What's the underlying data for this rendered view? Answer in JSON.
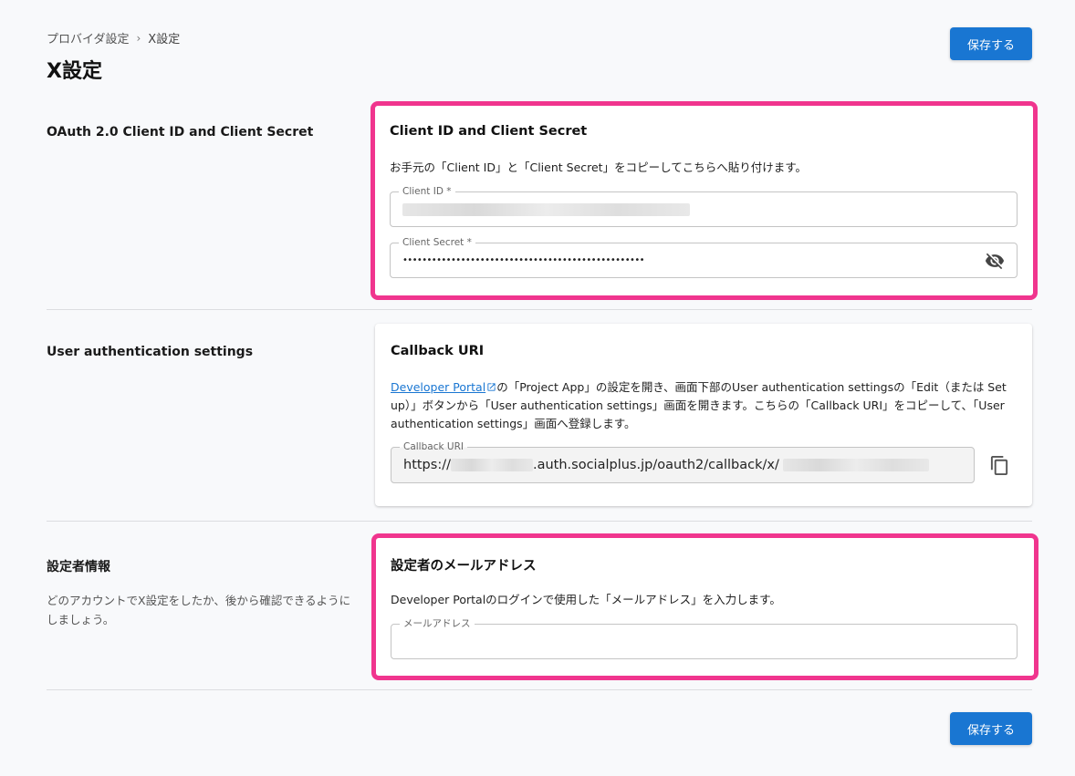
{
  "header": {
    "breadcrumb_parent": "プロバイダ設定",
    "breadcrumb_separator": "›",
    "breadcrumb_current": "X設定",
    "title": "X設定",
    "save_label": "保存する"
  },
  "sections": {
    "oauth": {
      "label": "OAuth 2.0 Client ID and Client Secret",
      "card_title": "Client ID and Client Secret",
      "instruction": "お手元の「Client ID」と「Client Secret」をコピーしてこちらへ貼り付けます。",
      "client_id_label": "Client ID *",
      "client_secret_label": "Client Secret *",
      "client_secret_value": "••••••••••••••••••••••••••••••••••••••••••••••••••"
    },
    "user_auth": {
      "label": "User authentication settings",
      "card_title": "Callback URI",
      "link_text": "Developer Portal",
      "instruction_rest": "の「Project App」の設定を開き、画面下部のUser authentication settingsの「Edit（または Set up）」ボタンから「User authentication settings」画面を開きます。こちらの「Callback URI」をコピーして、「User authentication settings」画面へ登録します。",
      "callback_label": "Callback URI",
      "callback_prefix": "https://",
      "callback_middle": ".auth.socialplus.jp/oauth2/callback/x/"
    },
    "operator": {
      "label": "設定者情報",
      "description": "どのアカウントでX設定をしたか、後から確認できるようにしましょう。",
      "card_title": "設定者のメールアドレス",
      "instruction": "Developer Portalのログインで使用した「メールアドレス」を入力します。",
      "email_label": "メールアドレス",
      "email_value": ""
    }
  },
  "colors": {
    "primary": "#1976d2",
    "highlight": "#f0358e"
  },
  "icons": {
    "visibility_toggle": "eye-off-icon",
    "copy": "copy-icon",
    "external_link": "external-link-icon"
  }
}
